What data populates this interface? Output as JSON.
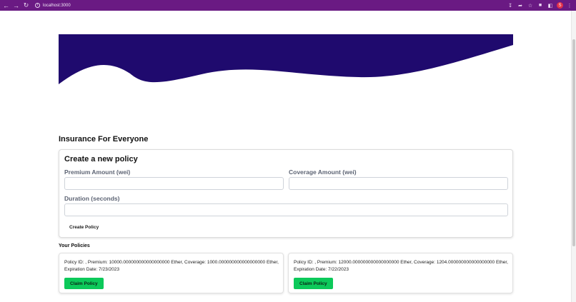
{
  "browser": {
    "url": "localhost:3000",
    "back_icon": "arrow-left",
    "forward_icon": "arrow-right",
    "reload_icon": "reload",
    "profile_initial": "S"
  },
  "colors": {
    "chrome": "#6a1a83",
    "wave": "#1f0a6e",
    "claim_button": "#0cc95a"
  },
  "app": {
    "heading": "Insurance For Everyone"
  },
  "form": {
    "title": "Create a new policy",
    "premium_label": "Premium Amount (wei)",
    "premium_value": "",
    "coverage_label": "Coverage Amount (wei)",
    "coverage_value": "",
    "duration_label": "Duration (seconds)",
    "duration_value": "",
    "submit_label": "Create Policy"
  },
  "policies": {
    "heading": "Your Policies",
    "items": [
      {
        "text": "Policy ID: , Premium: 10000.000000000000000000 Ether, Coverage: 1000.000000000000000000 Ether, Expiration Date: 7/23/2023",
        "button_label": "Claim Policy"
      },
      {
        "text": "Policy ID: , Premium: 12000.000000000000000000 Ether, Coverage: 1204.000000000000000000 Ether, Expiration Date: 7/22/2023",
        "button_label": "Claim Policy"
      }
    ]
  }
}
